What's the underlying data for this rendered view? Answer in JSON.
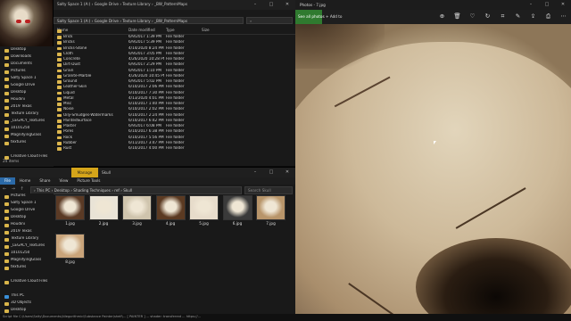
{
  "explorer_top": {
    "title": "Salty Space 1 (A:) › Google Drive › Texture Library › _BW_PatternMaps",
    "columns": [
      "Name",
      "Date modified",
      "Type",
      "Size"
    ],
    "status": "24 items",
    "nav_items": [
      "Desktop",
      "Downloads",
      "Documents",
      "Pictures",
      "Salty Space 1",
      "Google Drive",
      "Desktop",
      "Houdini",
      "2019 Texas",
      "Texture Library",
      "_LEGACY_Textures",
      "10101250",
      "MagnifyingGlass",
      "textures",
      "",
      "Creative Cloud Files",
      "",
      "This PC"
    ],
    "files": [
      {
        "name": "Brick",
        "date": "6/9/2017 1:39 PM",
        "type": "File folder"
      },
      {
        "name": "Bricks",
        "date": "6/9/2017 5:39 PM",
        "type": "File folder"
      },
      {
        "name": "Bricks-Stone",
        "date": "4/14/2020 8:24 PM",
        "type": "File folder"
      },
      {
        "name": "Cloth",
        "date": "6/9/2017 3:05 PM",
        "type": "File folder"
      },
      {
        "name": "Concrete",
        "date": "4/26/2020 10:28 PM",
        "type": "File folder"
      },
      {
        "name": "Dirt-Dust",
        "date": "6/9/2017 2:29 PM",
        "type": "File folder"
      },
      {
        "name": "Grain",
        "date": "6/9/2017 1:10 PM",
        "type": "File folder"
      },
      {
        "name": "Granite-Marble",
        "date": "4/26/2020 10:45 PM",
        "type": "File folder"
      },
      {
        "name": "Ground",
        "date": "6/9/2017 5:02 PM",
        "type": "File folder"
      },
      {
        "name": "Leather-Skin",
        "date": "6/10/2017 2:06 PM",
        "type": "File folder"
      },
      {
        "name": "Liquid",
        "date": "6/10/2017 7:30 PM",
        "type": "File folder"
      },
      {
        "name": "Metal",
        "date": "4/13/2020 4:01 PM",
        "type": "File folder"
      },
      {
        "name": "Misc",
        "date": "6/10/2017 1:40 PM",
        "type": "File folder"
      },
      {
        "name": "Noise",
        "date": "6/10/2017 2:02 PM",
        "type": "File folder"
      },
      {
        "name": "Oily-Smudges-Watermarks",
        "date": "6/10/2017 2:24 PM",
        "type": "File folder"
      },
      {
        "name": "PaintedSurface",
        "date": "6/10/2017 6:42 PM",
        "type": "File folder"
      },
      {
        "name": "Plaster",
        "date": "6/9/2017 6:08 PM",
        "type": "File folder"
      },
      {
        "name": "Pores",
        "date": "6/10/2017 6:38 PM",
        "type": "File folder"
      },
      {
        "name": "Rock",
        "date": "6/10/2017 5:56 PM",
        "type": "File folder"
      },
      {
        "name": "Rubber",
        "date": "6/11/2017 3:47 PM",
        "type": "File folder"
      },
      {
        "name": "Rust",
        "date": "6/10/2017 4:00 PM",
        "type": "File folder"
      }
    ]
  },
  "explorer_bottom": {
    "manage_label": "Manage",
    "window_label": "Skull",
    "ribbon": [
      "File",
      "Home",
      "Share",
      "View",
      "Picture Tools"
    ],
    "address": "› This PC › Desktop › Shading Techniques › ref › Skull",
    "search_placeholder": "Search Skull",
    "status": "8 items",
    "nav_items": [
      "Pictures",
      "Salty Space 1",
      "Google Drive",
      "Desktop",
      "Houdini",
      "2019 Texas",
      "Texture Library",
      "_LEGACY_Textures",
      "10101250",
      "MagnifyingGlass",
      "textures",
      "",
      "Creative Cloud Files",
      "",
      "This PC",
      "3D Objects",
      "Desktop"
    ],
    "thumbs": [
      {
        "label": "1.jpg",
        "tone": "#5a3a25"
      },
      {
        "label": "2.jpg",
        "tone": "#e9e3d6"
      },
      {
        "label": "3.jpg",
        "tone": "#cfc4ad"
      },
      {
        "label": "4.jpg",
        "tone": "#5b3a22"
      },
      {
        "label": "5.jpg",
        "tone": "#e7dccb"
      },
      {
        "label": "6.jpg",
        "tone": "#3a3a3a"
      },
      {
        "label": "7.jpg",
        "tone": "#b8956a"
      },
      {
        "label": "8.jpg",
        "tone": "#c9a47a"
      }
    ]
  },
  "photos": {
    "title": "Photos - 7.jpg",
    "see_all": "See all photos",
    "add_to": "+ Add to",
    "tool_icons": [
      "zoom-icon",
      "delete-icon",
      "favorite-icon",
      "rotate-icon",
      "crop-icon",
      "edit-icon",
      "share-icon",
      "print-icon",
      "more-icon"
    ]
  },
  "console": "Script file C:\\Users\\Salty\\Documents\\Allegorithmic\\Substance Painter\\shelf\\... [ PAINTER ] ... shader: transferred ... https://..."
}
